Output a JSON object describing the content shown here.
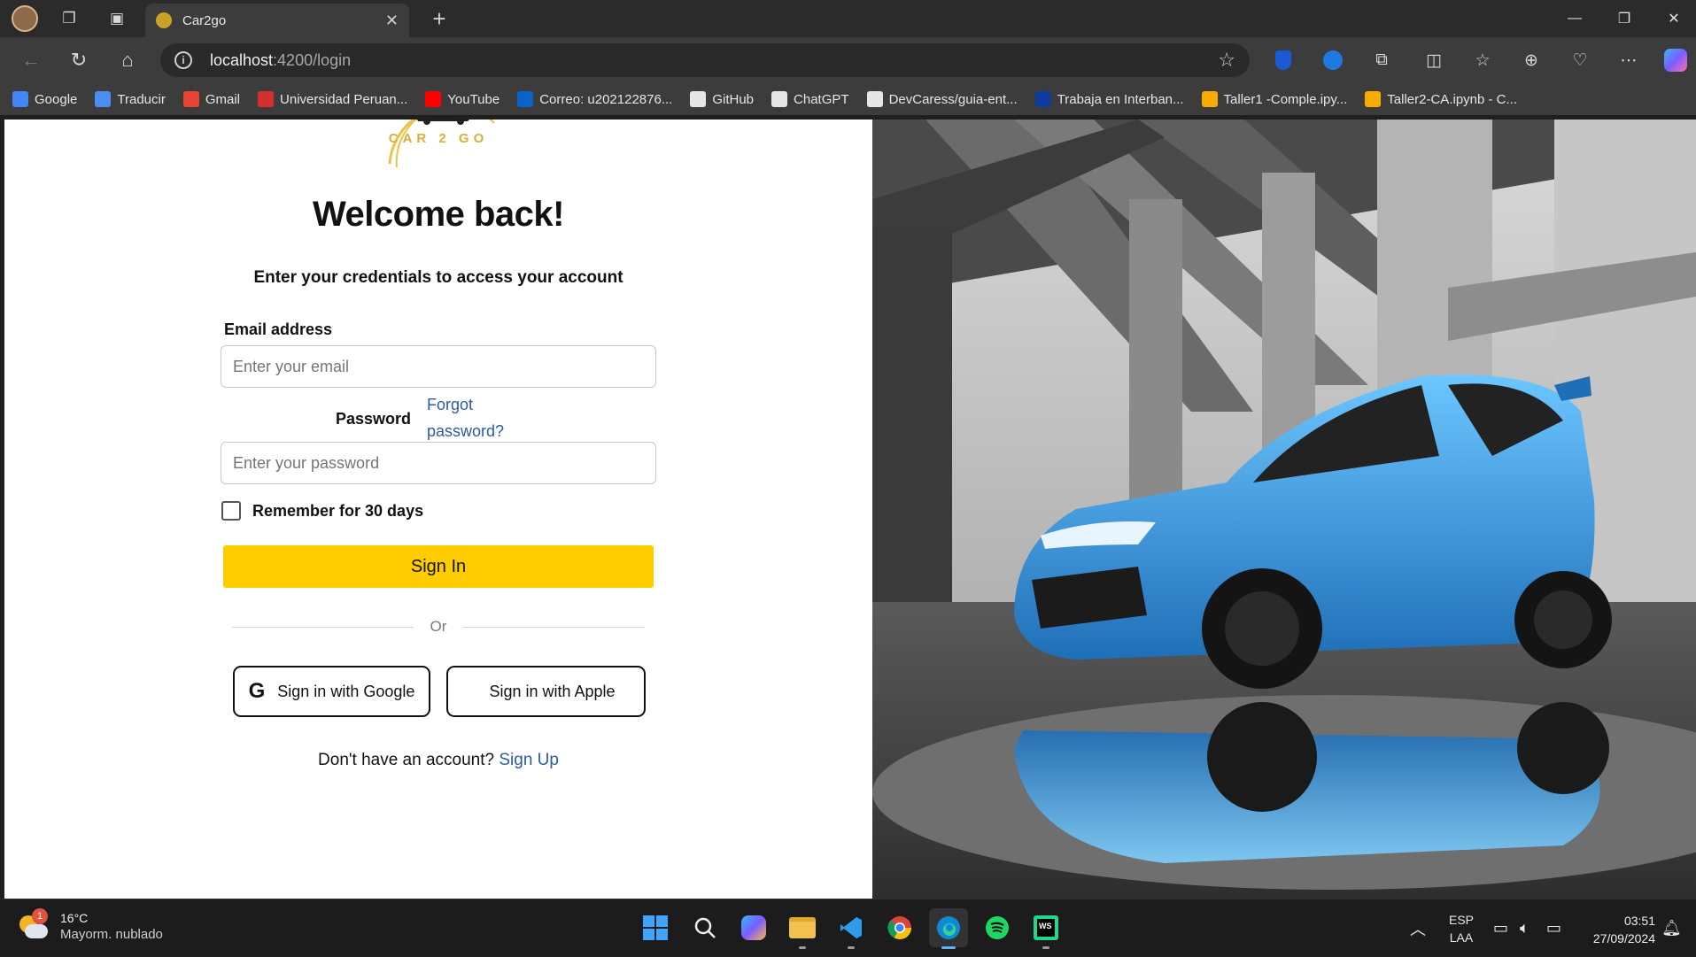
{
  "browser": {
    "tab_title": "Car2go",
    "url_host": "localhost",
    "url_path": ":4200/login",
    "bookmarks": [
      {
        "label": "Google",
        "icon": "google-icon",
        "color": "#4285f4"
      },
      {
        "label": "Traducir",
        "icon": "translate-icon",
        "color": "#4b8ef1"
      },
      {
        "label": "Gmail",
        "icon": "gmail-icon",
        "color": "#ea4335"
      },
      {
        "label": "Universidad Peruan...",
        "icon": "upc-icon",
        "color": "#d32f2f"
      },
      {
        "label": "YouTube",
        "icon": "youtube-icon",
        "color": "#ff0000"
      },
      {
        "label": "Correo: u202122876...",
        "icon": "outlook-icon",
        "color": "#0a64c8"
      },
      {
        "label": "GitHub",
        "icon": "github-icon",
        "color": "#e6e6e6"
      },
      {
        "label": "ChatGPT",
        "icon": "chatgpt-icon",
        "color": "#e6e6e6"
      },
      {
        "label": "DevCaress/guia-ent...",
        "icon": "github-icon",
        "color": "#e6e6e6"
      },
      {
        "label": "Trabaja en Interban...",
        "icon": "interbank-icon",
        "color": "#0d3c9e"
      },
      {
        "label": "Taller1 -Comple.ipy...",
        "icon": "colab-icon",
        "color": "#f9ab00"
      },
      {
        "label": "Taller2-CA.ipynb - C...",
        "icon": "colab-icon",
        "color": "#f9ab00"
      }
    ]
  },
  "page": {
    "logo_text": "CAR 2 GO",
    "heading": "Welcome back!",
    "subheading": "Enter your credentials to access your account",
    "email_label": "Email address",
    "email_placeholder": "Enter your email",
    "password_label": "Password",
    "forgot_label": "Forgot password?",
    "password_placeholder": "Enter your password",
    "remember_label": "Remember for 30 days",
    "signin_label": "Sign In",
    "or_label": "Or",
    "google_label": "Sign in with Google",
    "apple_label": "Sign in with Apple",
    "signup_prompt": "Don't have an account?",
    "signup_link": "Sign Up",
    "accent_color": "#ffcc00",
    "link_color": "#2d5ba7"
  },
  "taskbar": {
    "weather_temp": "16°C",
    "weather_cond": "Mayorm. nublado",
    "weather_badge": "1",
    "lang_top": "ESP",
    "lang_bottom": "LAA",
    "time": "03:51",
    "date": "27/09/2024"
  }
}
